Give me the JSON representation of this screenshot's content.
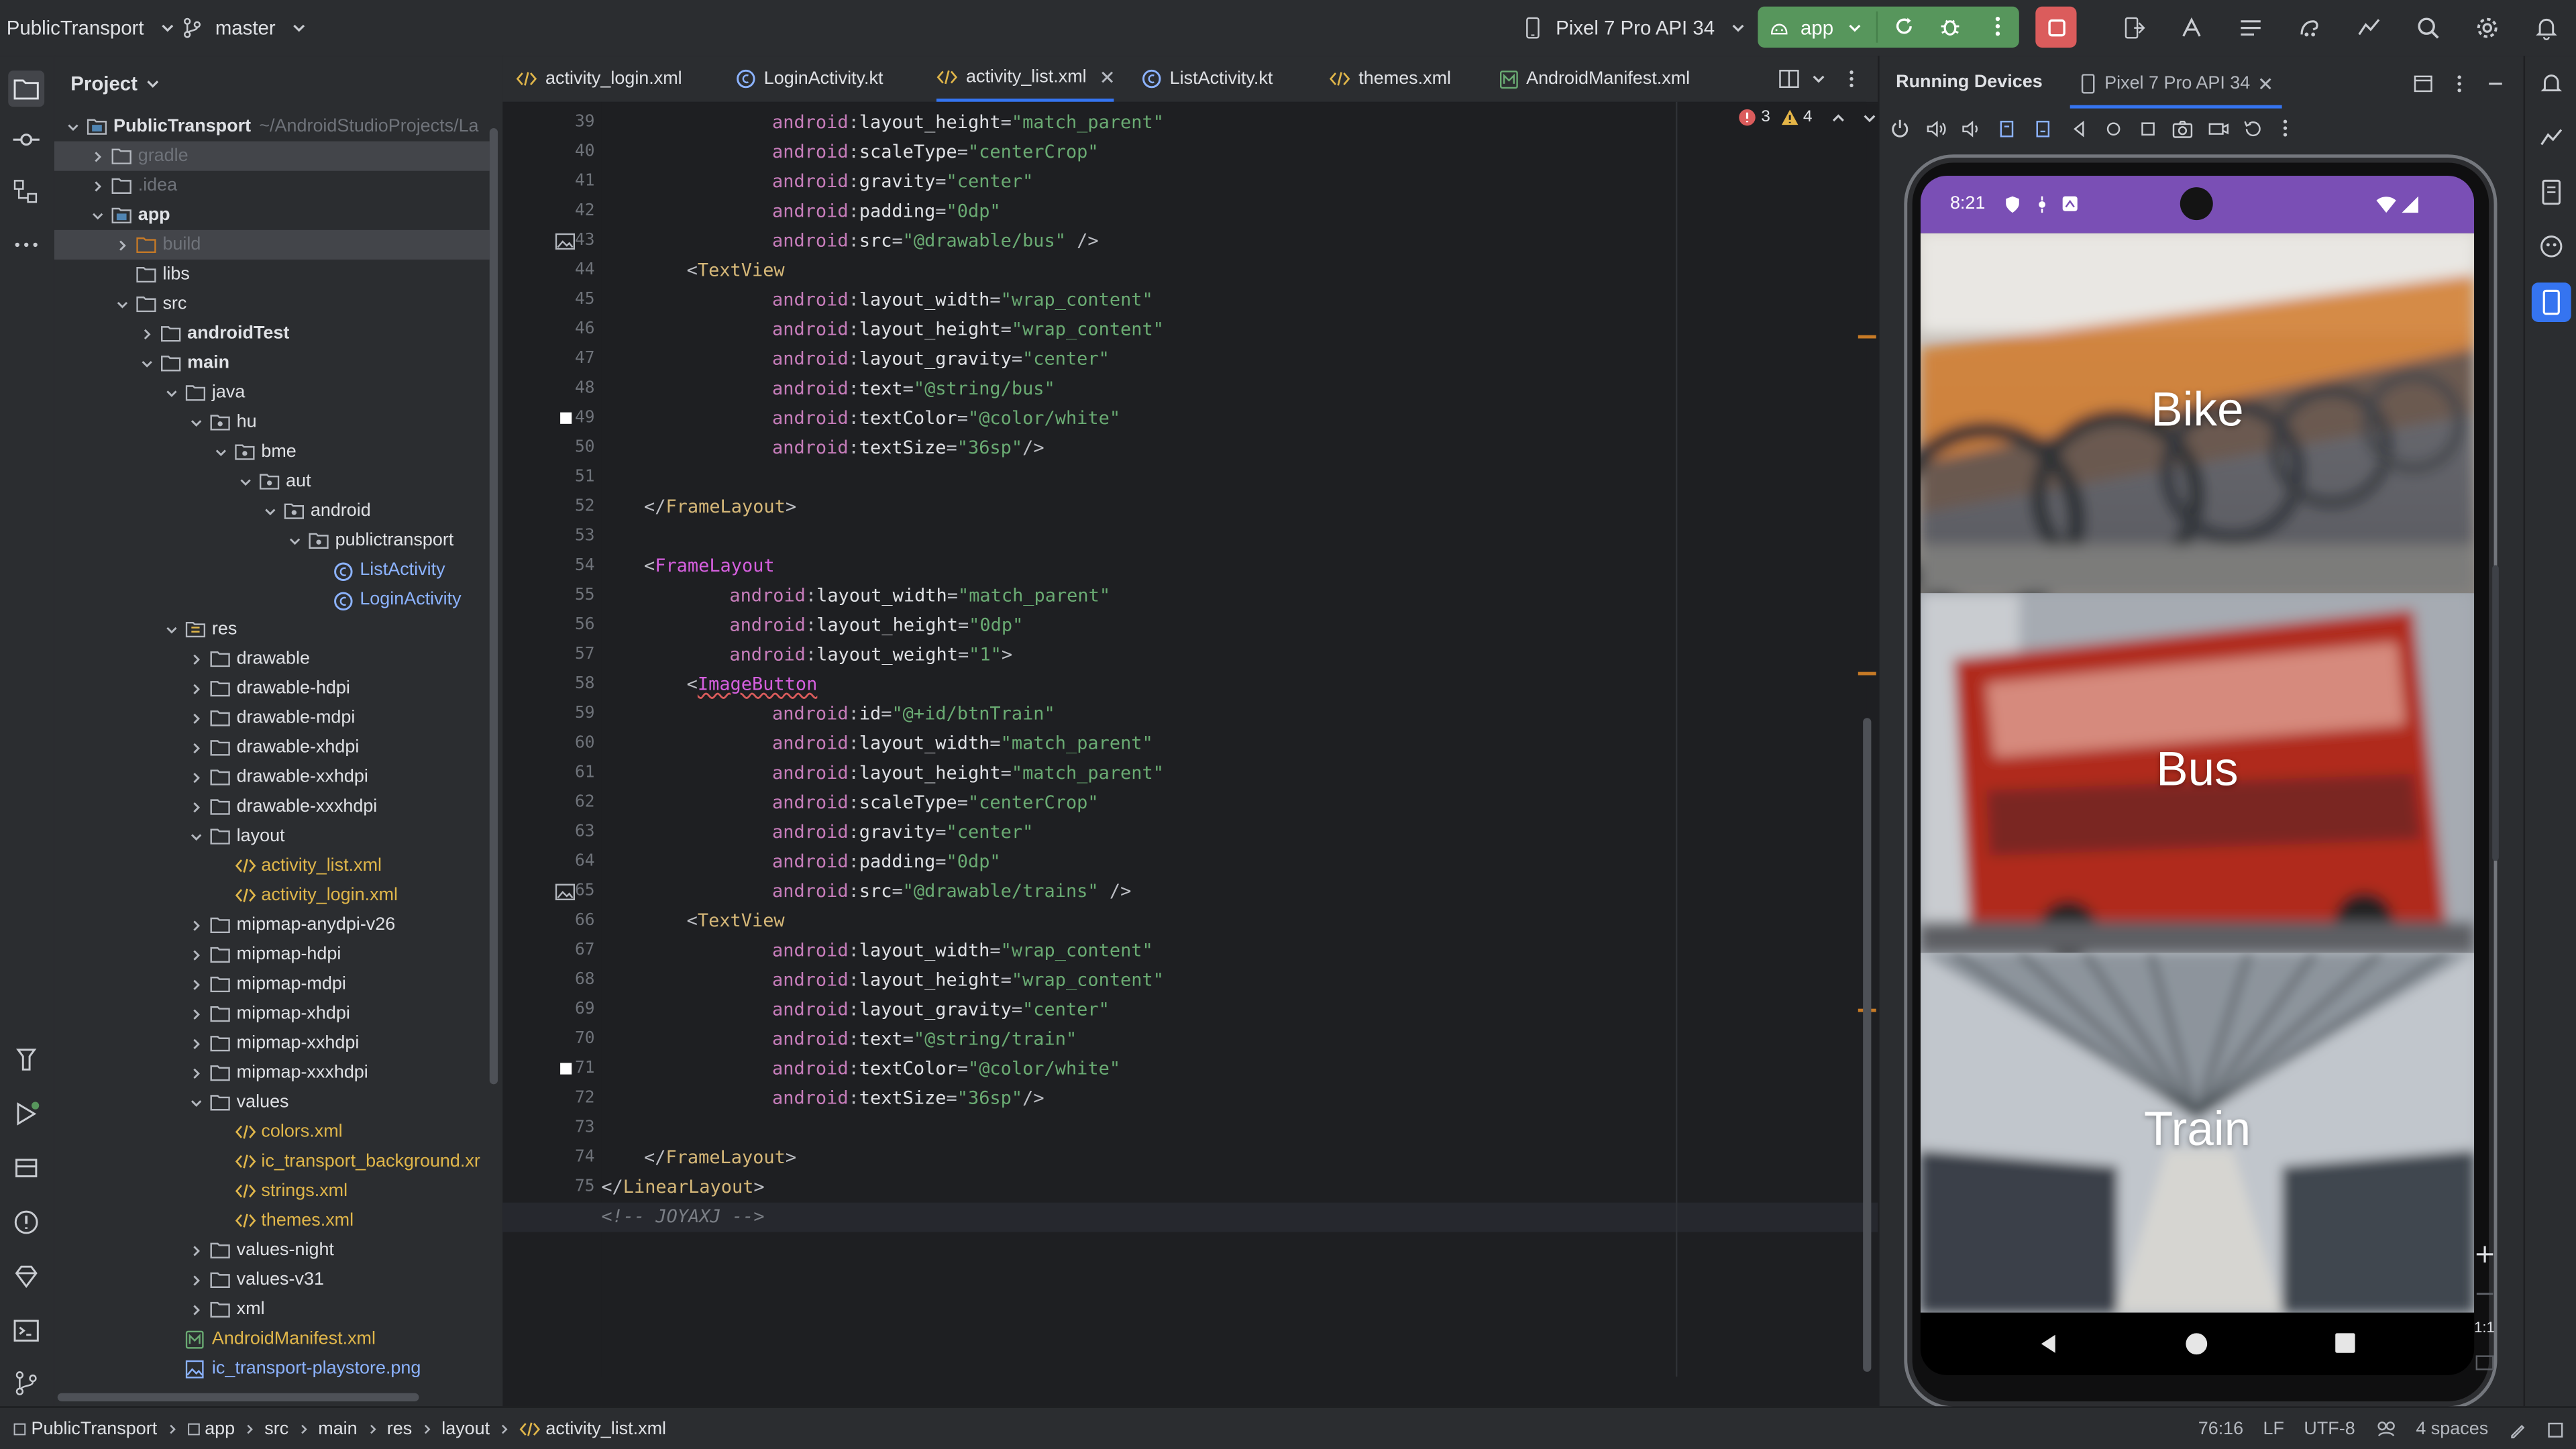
{
  "topbar": {
    "project_name": "PublicTransport",
    "branch": "master",
    "device": "Pixel 7 Pro API 34",
    "run_config": "app"
  },
  "project_panel": {
    "title": "Project",
    "root_name": "PublicTransport",
    "root_path": "~/AndroidStudioProjects/La",
    "items": [
      {
        "label": "gradle",
        "level": 1,
        "exp": "c",
        "kind": "folder",
        "style": "dim",
        "sel": true
      },
      {
        "label": ".idea",
        "level": 1,
        "exp": "c",
        "kind": "folder",
        "style": "dim"
      },
      {
        "label": "app",
        "level": 1,
        "exp": "o",
        "kind": "module",
        "style": "bold"
      },
      {
        "label": "build",
        "level": 2,
        "exp": "c",
        "kind": "folder-orange",
        "style": "dim",
        "sel": true
      },
      {
        "label": "libs",
        "level": 2,
        "exp": "",
        "kind": "folder",
        "style": ""
      },
      {
        "label": "src",
        "level": 2,
        "exp": "o",
        "kind": "folder",
        "style": ""
      },
      {
        "label": "androidTest",
        "level": 3,
        "exp": "c",
        "kind": "folder",
        "style": "bold"
      },
      {
        "label": "main",
        "level": 3,
        "exp": "o",
        "kind": "folder",
        "style": "bold"
      },
      {
        "label": "java",
        "level": 4,
        "exp": "o",
        "kind": "folder",
        "style": ""
      },
      {
        "label": "hu",
        "level": 5,
        "exp": "o",
        "kind": "package",
        "style": ""
      },
      {
        "label": "bme",
        "level": 6,
        "exp": "o",
        "kind": "package",
        "style": ""
      },
      {
        "label": "aut",
        "level": 7,
        "exp": "o",
        "kind": "package",
        "style": ""
      },
      {
        "label": "android",
        "level": 8,
        "exp": "o",
        "kind": "package",
        "style": ""
      },
      {
        "label": "publictransport",
        "level": 9,
        "exp": "o",
        "kind": "package",
        "style": ""
      },
      {
        "label": "ListActivity",
        "level": 10,
        "exp": "",
        "kind": "kotlin",
        "style": "blue"
      },
      {
        "label": "LoginActivity",
        "level": 10,
        "exp": "",
        "kind": "kotlin",
        "style": "blue"
      },
      {
        "label": "res",
        "level": 4,
        "exp": "o",
        "kind": "folder-res",
        "style": ""
      },
      {
        "label": "drawable",
        "level": 5,
        "exp": "c",
        "kind": "folder",
        "style": ""
      },
      {
        "label": "drawable-hdpi",
        "level": 5,
        "exp": "c",
        "kind": "folder",
        "style": ""
      },
      {
        "label": "drawable-mdpi",
        "level": 5,
        "exp": "c",
        "kind": "folder",
        "style": ""
      },
      {
        "label": "drawable-xhdpi",
        "level": 5,
        "exp": "c",
        "kind": "folder",
        "style": ""
      },
      {
        "label": "drawable-xxhdpi",
        "level": 5,
        "exp": "c",
        "kind": "folder",
        "style": ""
      },
      {
        "label": "drawable-xxxhdpi",
        "level": 5,
        "exp": "c",
        "kind": "folder",
        "style": ""
      },
      {
        "label": "layout",
        "level": 5,
        "exp": "o",
        "kind": "folder",
        "style": ""
      },
      {
        "label": "activity_list.xml",
        "level": 6,
        "exp": "",
        "kind": "xml",
        "style": "gold"
      },
      {
        "label": "activity_login.xml",
        "level": 6,
        "exp": "",
        "kind": "xml",
        "style": "gold"
      },
      {
        "label": "mipmap-anydpi-v26",
        "level": 5,
        "exp": "c",
        "kind": "folder",
        "style": ""
      },
      {
        "label": "mipmap-hdpi",
        "level": 5,
        "exp": "c",
        "kind": "folder",
        "style": ""
      },
      {
        "label": "mipmap-mdpi",
        "level": 5,
        "exp": "c",
        "kind": "folder",
        "style": ""
      },
      {
        "label": "mipmap-xhdpi",
        "level": 5,
        "exp": "c",
        "kind": "folder",
        "style": ""
      },
      {
        "label": "mipmap-xxhdpi",
        "level": 5,
        "exp": "c",
        "kind": "folder",
        "style": ""
      },
      {
        "label": "mipmap-xxxhdpi",
        "level": 5,
        "exp": "c",
        "kind": "folder",
        "style": ""
      },
      {
        "label": "values",
        "level": 5,
        "exp": "o",
        "kind": "folder",
        "style": ""
      },
      {
        "label": "colors.xml",
        "level": 6,
        "exp": "",
        "kind": "xml",
        "style": "gold"
      },
      {
        "label": "ic_transport_background.xr",
        "level": 6,
        "exp": "",
        "kind": "xml",
        "style": "gold"
      },
      {
        "label": "strings.xml",
        "level": 6,
        "exp": "",
        "kind": "xml",
        "style": "gold"
      },
      {
        "label": "themes.xml",
        "level": 6,
        "exp": "",
        "kind": "xml",
        "style": "gold"
      },
      {
        "label": "values-night",
        "level": 5,
        "exp": "c",
        "kind": "folder",
        "style": ""
      },
      {
        "label": "values-v31",
        "level": 5,
        "exp": "c",
        "kind": "folder",
        "style": ""
      },
      {
        "label": "xml",
        "level": 5,
        "exp": "c",
        "kind": "folder",
        "style": ""
      },
      {
        "label": "AndroidManifest.xml",
        "level": 4,
        "exp": "",
        "kind": "manifest",
        "style": "gold"
      },
      {
        "label": "ic_transport-playstore.png",
        "level": 4,
        "exp": "",
        "kind": "image",
        "style": "blue"
      }
    ]
  },
  "editor": {
    "tabs": [
      {
        "label": "activity_login.xml",
        "kind": "xml"
      },
      {
        "label": "LoginActivity.kt",
        "kind": "kotlin"
      },
      {
        "label": "activity_list.xml",
        "kind": "xml",
        "active": true
      },
      {
        "label": "ListActivity.kt",
        "kind": "kotlin"
      },
      {
        "label": "themes.xml",
        "kind": "xml"
      },
      {
        "label": "AndroidManifest.xml",
        "kind": "manifest"
      }
    ],
    "inspections": {
      "errors": "3",
      "warnings": "4"
    },
    "current_line": 76,
    "lines": [
      {
        "n": 39,
        "indent": 8,
        "t": "a",
        "attr": "layout_height",
        "val": "match_parent"
      },
      {
        "n": 40,
        "indent": 8,
        "t": "a",
        "attr": "scaleType",
        "val": "centerCrop"
      },
      {
        "n": 41,
        "indent": 8,
        "t": "a",
        "attr": "gravity",
        "val": "center"
      },
      {
        "n": 42,
        "indent": 8,
        "t": "a",
        "attr": "padding",
        "val": "0dp"
      },
      {
        "n": 43,
        "indent": 8,
        "t": "a",
        "attr": "src",
        "val": "@drawable/bus",
        "end": " />",
        "gutter": "image"
      },
      {
        "n": 44,
        "indent": 4,
        "t": "open",
        "tag": "TextView"
      },
      {
        "n": 45,
        "indent": 8,
        "t": "a",
        "attr": "layout_width",
        "val": "wrap_content"
      },
      {
        "n": 46,
        "indent": 8,
        "t": "a",
        "attr": "layout_height",
        "val": "wrap_content"
      },
      {
        "n": 47,
        "indent": 8,
        "t": "a",
        "attr": "layout_gravity",
        "val": "center"
      },
      {
        "n": 48,
        "indent": 8,
        "t": "a",
        "attr": "text",
        "val": "@string/bus"
      },
      {
        "n": 49,
        "indent": 8,
        "t": "a",
        "attr": "textColor",
        "val": "@color/white",
        "gutter": "color"
      },
      {
        "n": 50,
        "indent": 8,
        "t": "a",
        "attr": "textSize",
        "val": "36sp",
        "end": "/>"
      },
      {
        "n": 51,
        "t": "blank"
      },
      {
        "n": 52,
        "indent": 2,
        "t": "close",
        "tag": "FrameLayout"
      },
      {
        "n": 53,
        "t": "blank"
      },
      {
        "n": 54,
        "indent": 2,
        "t": "open",
        "tag": "FrameLayout",
        "tagcls": "tagc"
      },
      {
        "n": 55,
        "indent": 6,
        "t": "a",
        "attr": "layout_width",
        "val": "match_parent"
      },
      {
        "n": 56,
        "indent": 6,
        "t": "a",
        "attr": "layout_height",
        "val": "0dp"
      },
      {
        "n": 57,
        "indent": 6,
        "t": "a",
        "attr": "layout_weight",
        "val": "1",
        "end": ">"
      },
      {
        "n": 58,
        "indent": 4,
        "t": "open",
        "tag": "ImageButton",
        "tagcls": "tagc"
      },
      {
        "n": 59,
        "indent": 8,
        "t": "a",
        "attr": "id",
        "val": "@+id/btnTrain"
      },
      {
        "n": 60,
        "indent": 8,
        "t": "a",
        "attr": "layout_width",
        "val": "match_parent"
      },
      {
        "n": 61,
        "indent": 8,
        "t": "a",
        "attr": "layout_height",
        "val": "match_parent"
      },
      {
        "n": 62,
        "indent": 8,
        "t": "a",
        "attr": "scaleType",
        "val": "centerCrop"
      },
      {
        "n": 63,
        "indent": 8,
        "t": "a",
        "attr": "gravity",
        "val": "center"
      },
      {
        "n": 64,
        "indent": 8,
        "t": "a",
        "attr": "padding",
        "val": "0dp"
      },
      {
        "n": 65,
        "indent": 8,
        "t": "a",
        "attr": "src",
        "val": "@drawable/trains",
        "end": " />",
        "gutter": "image"
      },
      {
        "n": 66,
        "indent": 4,
        "t": "open",
        "tag": "TextView"
      },
      {
        "n": 67,
        "indent": 8,
        "t": "a",
        "attr": "layout_width",
        "val": "wrap_content"
      },
      {
        "n": 68,
        "indent": 8,
        "t": "a",
        "attr": "layout_height",
        "val": "wrap_content"
      },
      {
        "n": 69,
        "indent": 8,
        "t": "a",
        "attr": "layout_gravity",
        "val": "center"
      },
      {
        "n": 70,
        "indent": 8,
        "t": "a",
        "attr": "text",
        "val": "@string/train"
      },
      {
        "n": 71,
        "indent": 8,
        "t": "a",
        "attr": "textColor",
        "val": "@color/white",
        "gutter": "color"
      },
      {
        "n": 72,
        "indent": 8,
        "t": "a",
        "attr": "textSize",
        "val": "36sp",
        "end": "/>"
      },
      {
        "n": 73,
        "t": "blank"
      },
      {
        "n": 74,
        "indent": 2,
        "t": "close",
        "tag": "FrameLayout"
      },
      {
        "n": 75,
        "indent": 0,
        "t": "close",
        "tag": "LinearLayout"
      },
      {
        "n": 76,
        "indent": 0,
        "t": "comment",
        "text": "<!-- JOYAXJ -->"
      }
    ]
  },
  "emulator": {
    "tool_title": "Running Devices",
    "device_tab": "Pixel 7 Pro API 34",
    "phone": {
      "time": "8:21",
      "cards": [
        {
          "label": "Bike"
        },
        {
          "label": "Bus"
        },
        {
          "label": "Train"
        }
      ]
    },
    "zoom_label": "1:1"
  },
  "statusbar": {
    "breadcrumb": [
      "PublicTransport",
      "app",
      "src",
      "main",
      "res",
      "layout",
      "activity_list.xml"
    ],
    "position": "76:16",
    "line_sep": "LF",
    "encoding": "UTF-8",
    "indent": "4 spaces"
  },
  "colors": {
    "accent": "#3574f0",
    "run_green": "#57965c",
    "stop_red": "#db5c5c",
    "phone_status": "#7a4fb5"
  }
}
